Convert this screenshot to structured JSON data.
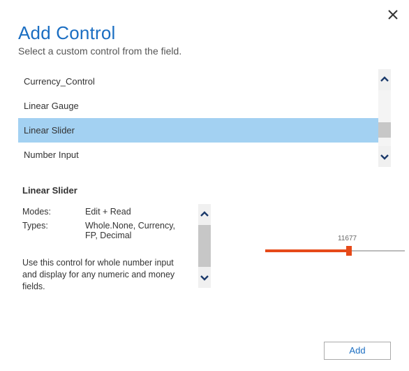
{
  "header": {
    "title": "Add Control",
    "subtitle": "Select a custom control from the field."
  },
  "list": {
    "items": [
      {
        "label": "Currency_Control",
        "selected": false
      },
      {
        "label": "Linear Gauge",
        "selected": false
      },
      {
        "label": "Linear Slider",
        "selected": true
      },
      {
        "label": "Number Input",
        "selected": false
      }
    ]
  },
  "detail": {
    "title": "Linear Slider",
    "modes_label": "Modes:",
    "modes_value": "Edit + Read",
    "types_label": "Types:",
    "types_value": "Whole.None, Currency, FP, Decimal",
    "description": "Use this control for whole number input and display for any numeric and money fields."
  },
  "preview": {
    "value_label": "11677"
  },
  "buttons": {
    "add": "Add"
  }
}
